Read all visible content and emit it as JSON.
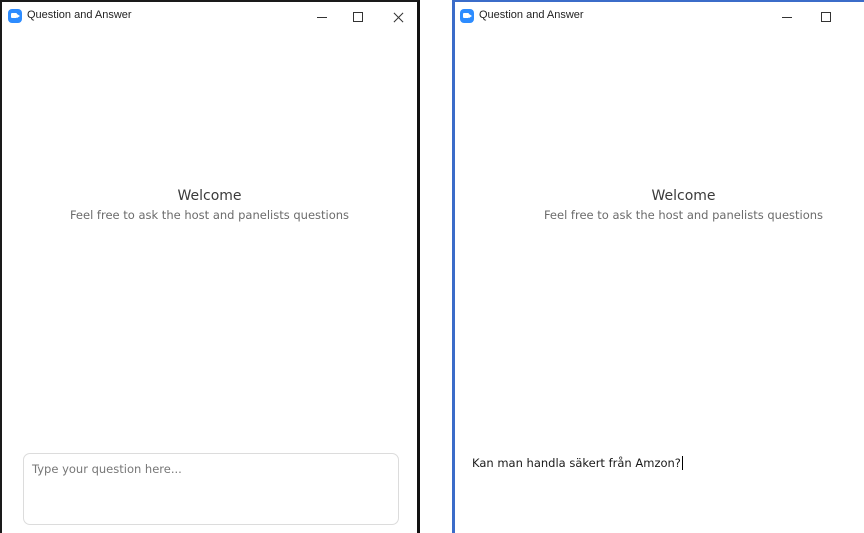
{
  "windows": [
    {
      "title": "Question and Answer",
      "welcome_title": "Welcome",
      "welcome_subtitle": "Feel free to ask the host and panelists questions",
      "question_placeholder": "Type your question here...",
      "question_value": ""
    },
    {
      "title": "Question and Answer",
      "welcome_title": "Welcome",
      "welcome_subtitle": "Feel free to ask the host and panelists questions",
      "question_value": "Kan man handla säkert från Amzon?"
    }
  ],
  "colors": {
    "app_icon": "#2d8cff",
    "active_border": "#3b6cc9"
  }
}
